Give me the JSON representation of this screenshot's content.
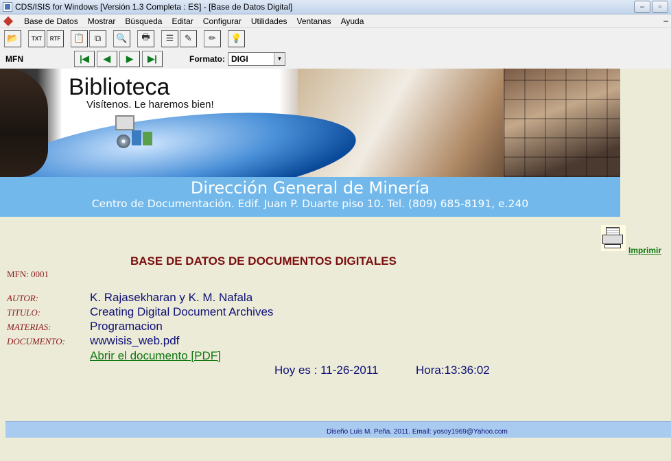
{
  "window": {
    "title": "CDS/ISIS for Windows [Versión 1.3 Completa : ES] - [Base de Datos Digital]",
    "controls": [
      "–",
      "▫"
    ]
  },
  "menubar": {
    "items": [
      "Base de Datos",
      "Mostrar",
      "Búsqueda",
      "Editar",
      "Configurar",
      "Utilidades",
      "Ventanas",
      "Ayuda"
    ],
    "right_glyph": "–"
  },
  "toolbar": {
    "buttons": [
      {
        "icon": "open-folder-icon",
        "glyph": "📂"
      },
      {
        "icon": "txt-file-icon",
        "glyph": "TXT"
      },
      {
        "icon": "rtf-file-icon",
        "glyph": "RTF"
      },
      {
        "icon": "clipboard-icon",
        "glyph": "📋"
      },
      {
        "icon": "copy-db-icon",
        "glyph": "⧉"
      },
      {
        "icon": "preview-icon",
        "glyph": "🔍"
      },
      {
        "icon": "print-icon",
        "glyph": "🖶"
      },
      {
        "icon": "list-icon",
        "glyph": "☰"
      },
      {
        "icon": "edit-record-icon",
        "glyph": "✎"
      },
      {
        "icon": "pencil-icon",
        "glyph": "✏"
      },
      {
        "icon": "lightbulb-icon",
        "glyph": "💡"
      }
    ]
  },
  "navrow": {
    "mfn_label": "MFN",
    "nav_buttons": [
      {
        "icon": "first-record-icon",
        "glyph": "|◀"
      },
      {
        "icon": "previous-record-icon",
        "glyph": "◀"
      },
      {
        "icon": "next-record-icon",
        "glyph": "▶"
      },
      {
        "icon": "last-record-icon",
        "glyph": "▶|"
      }
    ],
    "formato_label": "Formato:",
    "formato_value": "DIGI"
  },
  "banner": {
    "title": "Biblioteca",
    "subtitle": "Visítenos. Le haremos bien!"
  },
  "strip": {
    "title": "Dirección General de Minería",
    "subtitle": "Centro de Documentación. Edif. Juan P. Duarte piso 10. Tel. (809) 685-8191, e.240"
  },
  "print": {
    "label": "Imprimir"
  },
  "record": {
    "heading": "BASE DE DATOS DE DOCUMENTOS DIGITALES",
    "mfn": "MFN: 0001",
    "fields": [
      {
        "label": "AUTOR:",
        "value": "K. Rajasekharan y K. M. Nafala"
      },
      {
        "label": "TITULO:",
        "value": "Creating Digital Document Archives"
      },
      {
        "label": "MATERIAS:",
        "value": "Programacion"
      },
      {
        "label": "DOCUMENTO:",
        "value": "wwwisis_web.pdf"
      }
    ],
    "open_link": "Abrir el documento [PDF]",
    "date": "Hoy es : 11-26-2011",
    "time": "Hora:13:36:02"
  },
  "footer": {
    "credit": "Diseño Luis M. Peña. 2011. Email: yosoy1969@Yahoo.com"
  }
}
